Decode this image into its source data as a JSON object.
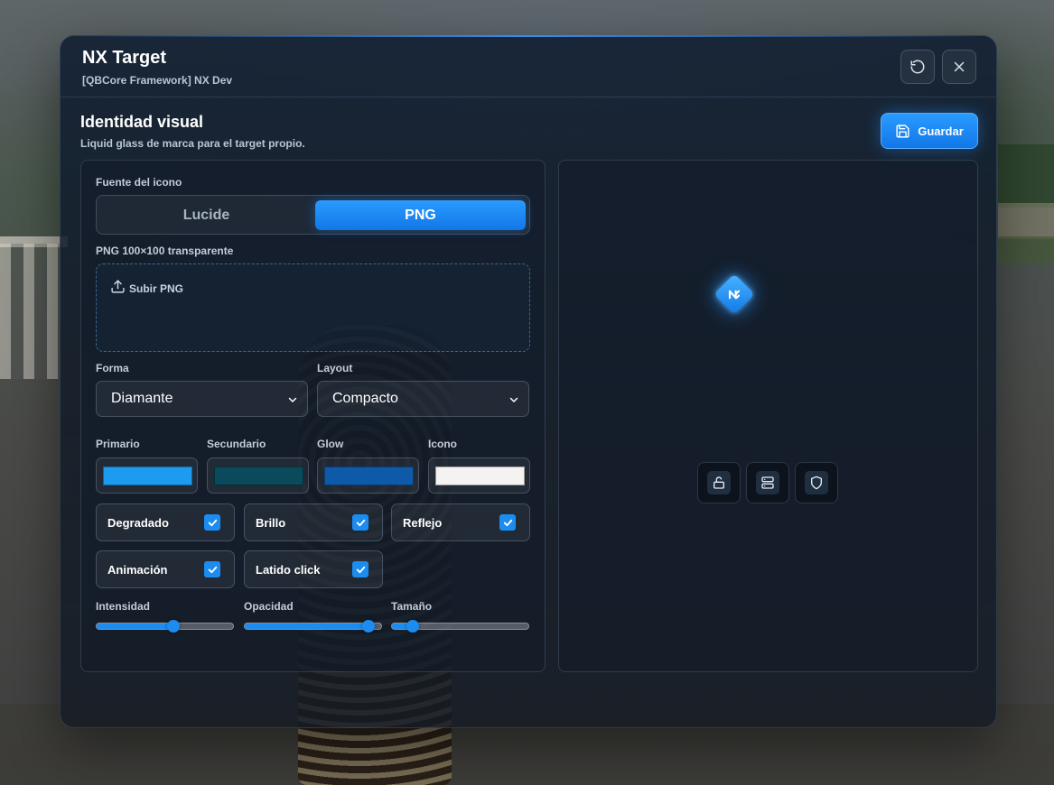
{
  "app": {
    "title": "NX Target",
    "subtitle": "[QBCore Framework] NX Dev"
  },
  "header_actions": {
    "reset_icon": "rotate-ccw-icon",
    "close_icon": "x-icon"
  },
  "section": {
    "title": "Identidad visual",
    "subtitle": "Liquid glass de marca para el target propio.",
    "save_label": "Guardar",
    "save_icon": "save-icon"
  },
  "icon_source": {
    "label": "Fuente del icono",
    "options": [
      "Lucide",
      "PNG"
    ],
    "selected": "PNG"
  },
  "png_upload": {
    "label": "PNG 100×100 transparente",
    "button_label": "Subir PNG",
    "icon": "upload-icon"
  },
  "shape": {
    "label": "Forma",
    "value": "Diamante"
  },
  "layout": {
    "label": "Layout",
    "value": "Compacto"
  },
  "colors": [
    {
      "label": "Primario",
      "value": "#1d9bf0"
    },
    {
      "label": "Secundario",
      "value": "#0a4a5a"
    },
    {
      "label": "Glow",
      "value": "#0f5aa8"
    },
    {
      "label": "Icono",
      "value": "#f5f3f1"
    }
  ],
  "toggles": [
    {
      "label": "Degradado",
      "checked": true
    },
    {
      "label": "Brillo",
      "checked": true
    },
    {
      "label": "Reflejo",
      "checked": true
    },
    {
      "label": "Animación",
      "checked": true
    },
    {
      "label": "Latido click",
      "checked": true
    }
  ],
  "sliders": [
    {
      "label": "Intensidad",
      "value": 0.57
    },
    {
      "label": "Opacidad",
      "value": 0.95
    },
    {
      "label": "Tamaño",
      "value": 0.12
    }
  ],
  "preview": {
    "logo_icon": "nx-logo-icon",
    "option_icons": [
      "lock-open-icon",
      "server-icon",
      "shield-icon"
    ]
  },
  "accent_color": "#1c8cf0"
}
